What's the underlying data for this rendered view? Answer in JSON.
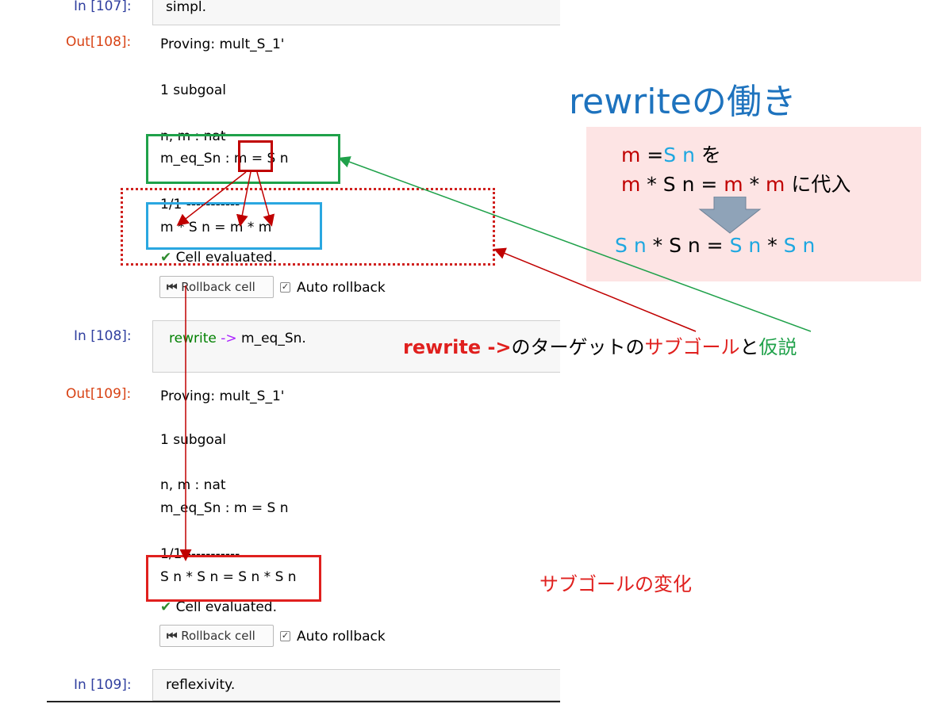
{
  "cells": {
    "in107": {
      "prompt": "In [107]:",
      "code": "simpl."
    },
    "out108": {
      "prompt": "Out[108]:",
      "proving": "Proving: mult_S_1'",
      "subgoals": "1 subgoal",
      "hyp1": "n, m : nat",
      "hyp2": "m_eq_Sn : m = S n",
      "separator": "1/1 -----------",
      "goal": "m * S n = m * m",
      "evaluated": "Cell evaluated."
    },
    "controls1": {
      "rollback_label": "Rollback cell",
      "auto_label": "Auto rollback"
    },
    "in108": {
      "prompt": "In [108]:",
      "code_kw": "rewrite",
      "code_arrow": "->",
      "code_rest": "m_eq_Sn."
    },
    "out109": {
      "prompt": "Out[109]:",
      "proving": "Proving: mult_S_1'",
      "subgoals": "1 subgoal",
      "hyp1": "n, m : nat",
      "hyp2": "m_eq_Sn : m = S n",
      "separator": "1/1 -----------",
      "goal": "S n * S n = S n * S n",
      "evaluated": "Cell evaluated."
    },
    "controls2": {
      "rollback_label": "Rollback cell",
      "auto_label": "Auto rollback"
    },
    "in109": {
      "prompt": "In [109]:",
      "code": "reflexivity."
    }
  },
  "annotations": {
    "title": "rewriteの働き",
    "box_line1": {
      "m": "m",
      "eq": " =",
      "sn": "S n",
      "wo": " を"
    },
    "box_line2": {
      "m1": "m",
      "mid": " * S n = ",
      "m2": "m",
      "star": " * ",
      "m3": "m",
      "tail": " に代入"
    },
    "box_line3": {
      "sn1": "S n",
      "mid": " * S n = ",
      "sn2": "S n",
      "star": " * ",
      "sn3": "S n"
    },
    "caption": {
      "kw": "rewrite ->",
      "text1": "のターゲットの",
      "subgoal": "サブゴール",
      "to": "と",
      "hyp": "仮説"
    },
    "change_label": "サブゴールの変化"
  },
  "colors": {
    "prompt_in": "#303f9f",
    "prompt_out": "#d84315",
    "green_box": "#1fa14a",
    "red_box": "#d0201e",
    "blue_box": "#2aa7e0",
    "dark_red": "#c00000",
    "cyan": "#1ea7e0",
    "title_blue": "#1e73be",
    "pink_bg": "#fde4e4"
  }
}
